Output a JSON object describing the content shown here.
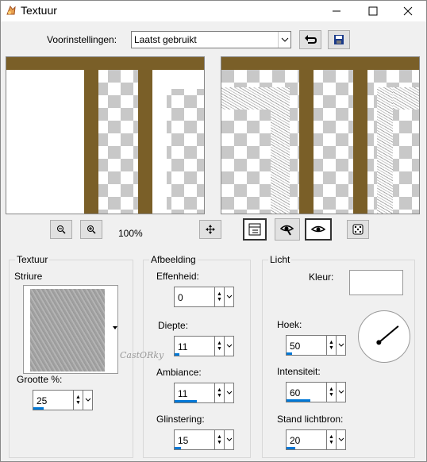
{
  "window": {
    "title": "Textuur",
    "icon": "app-icon",
    "minimize": "—",
    "maximize": "☐",
    "close": "✕"
  },
  "presets": {
    "label": "Voorinstellingen:",
    "value": "Laatst gebruikt"
  },
  "toolbar": {
    "zoom_level": "100%"
  },
  "texture": {
    "group_label": "Textuur",
    "name": "Striure",
    "size_label": "Grootte %:",
    "size_value": "25",
    "size_fill": 0.25
  },
  "image": {
    "group_label": "Afbeelding",
    "smoothness_label": "Effenheid:",
    "smoothness_value": "0",
    "smoothness_fill": 0,
    "depth_label": "Diepte:",
    "depth_value": "11",
    "depth_fill": 0.11,
    "ambiance_label": "Ambiance:",
    "ambiance_value": "11",
    "ambiance_fill": 0.55,
    "shininess_label": "Glinstering:",
    "shininess_value": "15",
    "shininess_fill": 0.15
  },
  "light": {
    "group_label": "Licht",
    "color_label": "Kleur:",
    "color_value": "#ffffff",
    "angle_label": "Hoek:",
    "angle_value": "50",
    "angle_fill": 0.14,
    "intensity_label": "Intensiteit:",
    "intensity_value": "60",
    "intensity_fill": 0.6,
    "elevation_label": "Stand lichtbron:",
    "elevation_value": "20",
    "elevation_fill": 0.22
  },
  "watermark": "CastORky",
  "colors": {
    "accent": "#0078d7",
    "brown": "#7a5f28"
  }
}
